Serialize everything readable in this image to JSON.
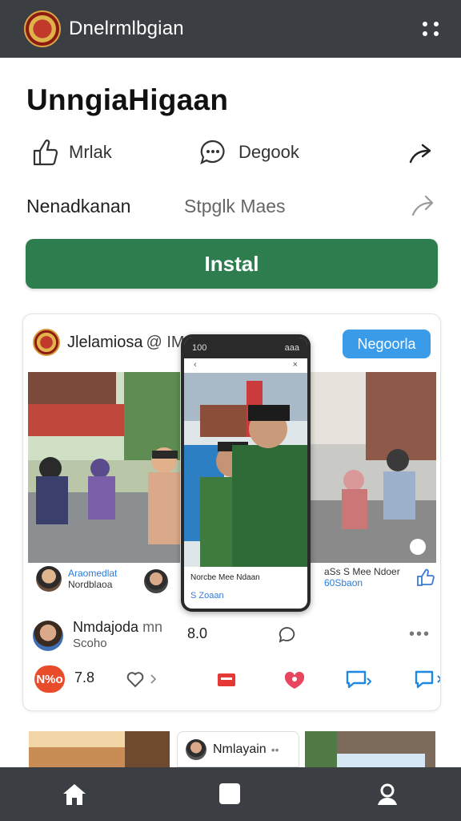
{
  "header": {
    "app_title": "Dnelrmlbgian",
    "logo_icon": "seal-logo-icon",
    "menu_icon": "grid-menu-icon"
  },
  "page": {
    "title": "UnngiaHigaan"
  },
  "actions": {
    "like_label": "Mrlak",
    "comment_label": "Degook",
    "share_icon": "share-arrow-icon"
  },
  "meta_row": {
    "left": "Nenadkanan",
    "middle": "Stpglk Maes"
  },
  "install_button": "Instal",
  "post": {
    "account_name": "Jlelamiosa",
    "account_suffix": "@ IM",
    "follow_button": "Negoorla",
    "phone": {
      "time": "100",
      "signal": "aaa",
      "caption": "Norcbe Mee Ndaan",
      "sub": "S Zoaan"
    },
    "mini_left": {
      "title": "Araomedlat",
      "subtitle": "Nordblaoa"
    },
    "mini_right": {
      "title": "aSs S Mee Ndoer",
      "subtitle": "60Sbaon"
    },
    "author": {
      "name": "Nmdajoda",
      "suffix": "mn",
      "subtitle": "Scoho",
      "count": "8.0"
    },
    "reactions": {
      "badge": "N%o",
      "count": "7.8"
    }
  },
  "bottom_strip": {
    "chip_name": "Nmlayain",
    "chip_more": "••"
  },
  "bottom_nav": [
    "home-icon",
    "square-icon",
    "profile-icon"
  ],
  "colors": {
    "topbar": "#3b3e42",
    "install_green": "#2e7d4f",
    "follow_blue": "#3a9be8",
    "badge_red": "#e94c2a"
  }
}
